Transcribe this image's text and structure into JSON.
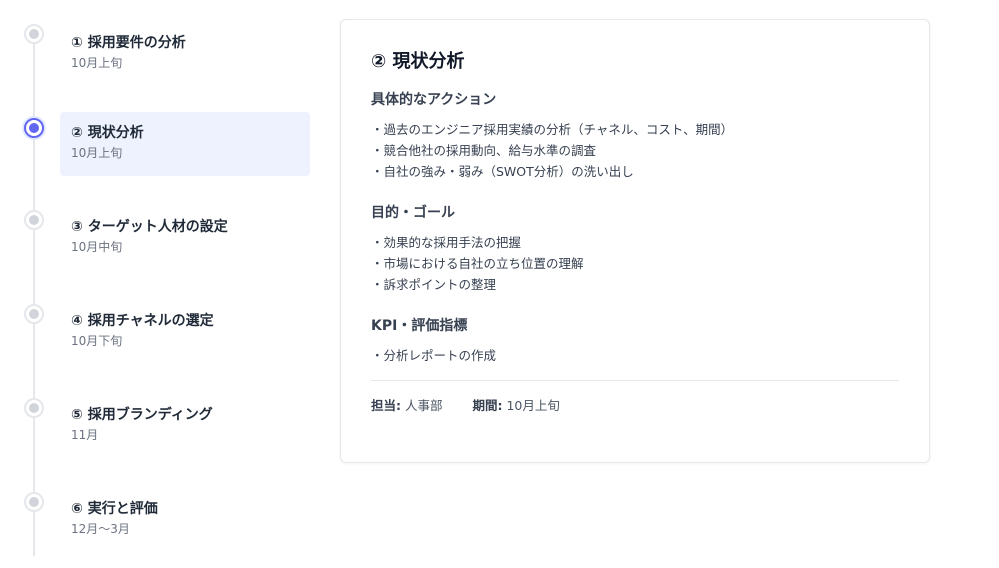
{
  "steps": [
    {
      "title": "① 採用要件の分析",
      "date": "10月上旬"
    },
    {
      "title": "② 現状分析",
      "date": "10月上旬"
    },
    {
      "title": "③ ターゲット人材の設定",
      "date": "10月中旬"
    },
    {
      "title": "④ 採用チャネルの選定",
      "date": "10月下旬"
    },
    {
      "title": "⑤ 採用ブランディング",
      "date": "11月"
    },
    {
      "title": "⑥ 実行と評価",
      "date": "12月〜3月"
    }
  ],
  "detail": {
    "title": "② 現状分析",
    "sections": [
      {
        "heading": "具体的なアクション",
        "items": [
          "・過去のエンジニア採用実績の分析（チャネル、コスト、期間）",
          "・競合他社の採用動向、給与水準の調査",
          "・自社の強み・弱み（SWOT分析）の洗い出し"
        ]
      },
      {
        "heading": "目的・ゴール",
        "items": [
          "・効果的な採用手法の把握",
          "・市場における自社の立ち位置の理解",
          "・訴求ポイントの整理"
        ]
      },
      {
        "heading": "KPI・評価指標",
        "items": [
          "・分析レポートの作成"
        ]
      }
    ],
    "meta": {
      "owner_label": "担当:",
      "owner": "人事部",
      "period_label": "期間:",
      "period": "10月上旬"
    }
  },
  "colors": {
    "accent": "#6366f1",
    "active_bg": "#eef2ff",
    "dot_inactive": "#d1d5db",
    "line": "#e5e7eb"
  }
}
